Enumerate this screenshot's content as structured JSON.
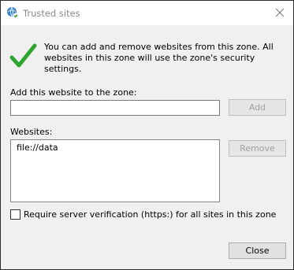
{
  "window": {
    "title": "Trusted sites",
    "icon": "globe-check-icon",
    "close_icon": "close-icon"
  },
  "info": {
    "icon": "green-checkmark-icon",
    "text": "You can add and remove websites from this zone. All websites in this zone will use the zone's security settings."
  },
  "add_section": {
    "label": "Add this website to the zone:",
    "input_value": "",
    "add_label": "Add"
  },
  "websites": {
    "label": "Websites:",
    "items": [
      "file://data"
    ],
    "remove_label": "Remove"
  },
  "require_https": {
    "label": "Require server verification (https:) for all sites in this zone",
    "checked": false
  },
  "footer": {
    "close_label": "Close"
  }
}
